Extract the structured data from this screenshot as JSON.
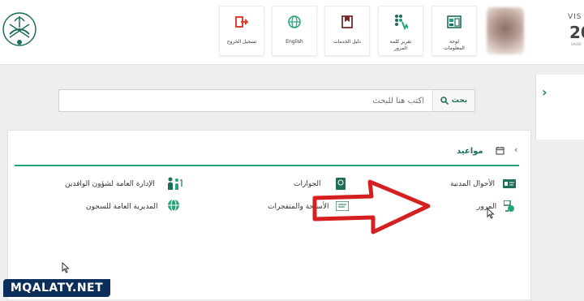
{
  "header": {
    "tiles": [
      {
        "id": "logout",
        "label": "تسجيل الخروج",
        "icon": "logout-icon"
      },
      {
        "id": "english",
        "label": "English",
        "icon": "globe-icon"
      },
      {
        "id": "services-guide",
        "label": "دليل الخدمات",
        "icon": "book-icon"
      },
      {
        "id": "traffic-report",
        "label": "تقرير كلمة\nالمرور",
        "icon": "traffic-icon"
      },
      {
        "id": "dashboard",
        "label": "لوحة\nالمعلومات",
        "icon": "dashboard-icon"
      }
    ],
    "vision": {
      "label": "VIS",
      "number": "20",
      "sub": "SAUDI"
    }
  },
  "search": {
    "placeholder": "اكتب هنا للبحث",
    "button_label": "بحث"
  },
  "appointments": {
    "title": "مواعيد",
    "services": [
      {
        "id": "civil-affairs",
        "label": "الأحوال المدنية"
      },
      {
        "id": "passports",
        "label": "الجوازات"
      },
      {
        "id": "expat-affairs",
        "label": "الإدارة العامة لشؤون الوافدين"
      },
      {
        "id": "traffic",
        "label": "المرور"
      },
      {
        "id": "weapons",
        "label": "الأسلحة والمتفجرات"
      },
      {
        "id": "prisons",
        "label": "المديرية العامة للسجون"
      }
    ]
  },
  "watermark": "MQALATY.NET",
  "colors": {
    "brand": "#1e6e58",
    "accent": "#27a37a",
    "arrow": "#d42020",
    "logout": "#d9432f"
  }
}
